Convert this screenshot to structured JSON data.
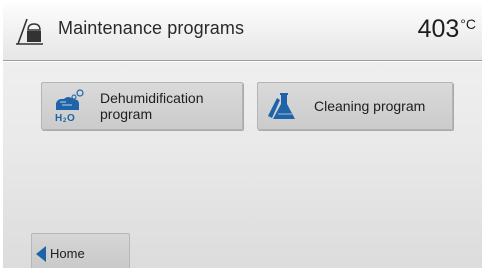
{
  "header": {
    "title": "Maintenance programs",
    "temperature": "403",
    "temperature_unit": "°C",
    "icon": "furnace-maintenance-icon"
  },
  "buttons": [
    {
      "label_line1": "Dehumidification",
      "label_line2": "program",
      "icon": "dehumidification-icon"
    },
    {
      "label": "Cleaning program",
      "icon": "cleaning-flask-icon"
    }
  ],
  "footer": {
    "home_label": "Home",
    "icon": "back-arrow-icon"
  },
  "colors": {
    "icon_blue": "#1f63a8",
    "button_face": "#cfcfcf",
    "header_border": "#9d9d9d"
  }
}
